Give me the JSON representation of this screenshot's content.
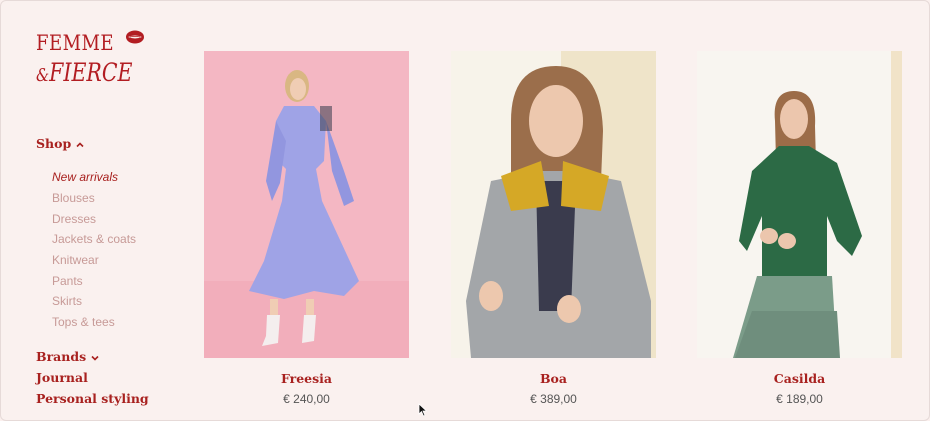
{
  "brand": {
    "line1": "FEMME",
    "line2_amp": "&",
    "line2": "FIERCE"
  },
  "nav": {
    "shop": "Shop",
    "shop_items": [
      {
        "label": "New arrivals",
        "active": true
      },
      {
        "label": "Blouses"
      },
      {
        "label": "Dresses"
      },
      {
        "label": "Jackets & coats"
      },
      {
        "label": "Knitwear"
      },
      {
        "label": "Pants"
      },
      {
        "label": "Skirts"
      },
      {
        "label": "Tops & tees"
      }
    ],
    "brands": "Brands",
    "journal": "Journal",
    "personal_styling": "Personal styling"
  },
  "products": [
    {
      "name": "Freesia",
      "price": "€ 240,00"
    },
    {
      "name": "Boa",
      "price": "€ 389,00"
    },
    {
      "name": "Casilda",
      "price": "€ 189,00"
    }
  ],
  "colors": {
    "accent": "#a8211f",
    "muted": "#c79a97",
    "background": "#faf1ef"
  }
}
